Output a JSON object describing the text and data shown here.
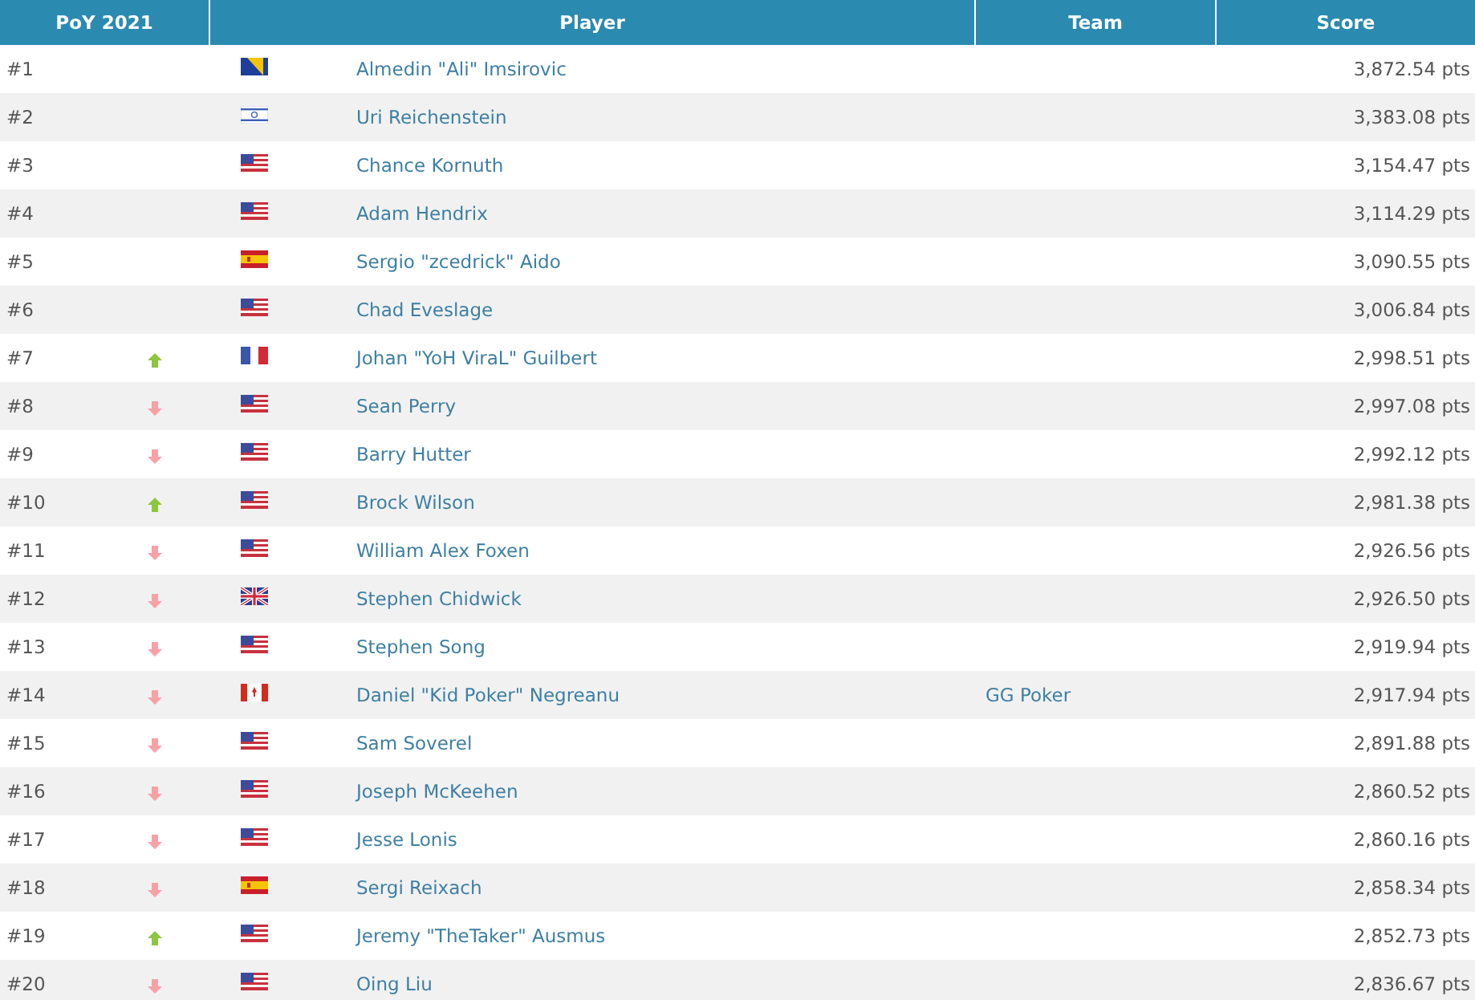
{
  "table": {
    "columns": [
      "PoY 2021",
      "Player",
      "Team",
      "Score"
    ],
    "rows": [
      {
        "rank": "#1",
        "flag": {
          "kind": "ba"
        },
        "player": "Almedin \"Ali\" Imsirovic",
        "score": "3,872.54 pts"
      },
      {
        "rank": "#2",
        "flag": {
          "kind": "il"
        },
        "player": "Uri Reichenstein",
        "score": "3,383.08 pts"
      },
      {
        "rank": "#3",
        "flag": {
          "kind": "us"
        },
        "player": "Chance Kornuth",
        "score": "3,154.47 pts"
      },
      {
        "rank": "#4",
        "flag": {
          "kind": "us"
        },
        "player": "Adam Hendrix",
        "score": "3,114.29 pts"
      },
      {
        "rank": "#5",
        "flag": {
          "kind": "es"
        },
        "player": "Sergio \"zcedrick\" Aido",
        "score": "3,090.55 pts"
      },
      {
        "rank": "#6",
        "flag": {
          "kind": "us"
        },
        "player": "Chad Eveslage",
        "score": "3,006.84 pts"
      },
      {
        "rank": "#7",
        "trend": {
          "kind": "up"
        },
        "flag": {
          "kind": "fr"
        },
        "player": "Johan \"YoH ViraL\" Guilbert",
        "score": "2,998.51 pts"
      },
      {
        "rank": "#8",
        "trend": {
          "kind": "down"
        },
        "flag": {
          "kind": "us"
        },
        "player": "Sean Perry",
        "score": "2,997.08 pts"
      },
      {
        "rank": "#9",
        "trend": {
          "kind": "down"
        },
        "flag": {
          "kind": "us"
        },
        "player": "Barry Hutter",
        "score": "2,992.12 pts"
      },
      {
        "rank": "#10",
        "trend": {
          "kind": "up"
        },
        "flag": {
          "kind": "us"
        },
        "player": "Brock Wilson",
        "score": "2,981.38 pts"
      },
      {
        "rank": "#11",
        "trend": {
          "kind": "down"
        },
        "flag": {
          "kind": "us"
        },
        "player": "William Alex Foxen",
        "score": "2,926.56 pts"
      },
      {
        "rank": "#12",
        "trend": {
          "kind": "down"
        },
        "flag": {
          "kind": "gb"
        },
        "player": "Stephen Chidwick",
        "score": "2,926.50 pts"
      },
      {
        "rank": "#13",
        "trend": {
          "kind": "down"
        },
        "flag": {
          "kind": "us"
        },
        "player": "Stephen Song",
        "score": "2,919.94 pts"
      },
      {
        "rank": "#14",
        "trend": {
          "kind": "down"
        },
        "flag": {
          "kind": "ca"
        },
        "player": "Daniel \"Kid Poker\" Negreanu",
        "team": "GG Poker",
        "score": "2,917.94 pts"
      },
      {
        "rank": "#15",
        "trend": {
          "kind": "down"
        },
        "flag": {
          "kind": "us"
        },
        "player": "Sam Soverel",
        "score": "2,891.88 pts"
      },
      {
        "rank": "#16",
        "trend": {
          "kind": "down"
        },
        "flag": {
          "kind": "us"
        },
        "player": "Joseph McKeehen",
        "score": "2,860.52 pts"
      },
      {
        "rank": "#17",
        "trend": {
          "kind": "down"
        },
        "flag": {
          "kind": "us"
        },
        "player": "Jesse Lonis",
        "score": "2,860.16 pts"
      },
      {
        "rank": "#18",
        "trend": {
          "kind": "down"
        },
        "flag": {
          "kind": "es"
        },
        "player": "Sergi Reixach",
        "score": "2,858.34 pts"
      },
      {
        "rank": "#19",
        "trend": {
          "kind": "up"
        },
        "flag": {
          "kind": "us"
        },
        "player": "Jeremy \"TheTaker\" Ausmus",
        "score": "2,852.73 pts"
      },
      {
        "rank": "#20",
        "trend": {
          "kind": "down"
        },
        "flag": {
          "kind": "us"
        },
        "player": "Oing Liu",
        "score": "2,836.67 pts"
      }
    ]
  }
}
